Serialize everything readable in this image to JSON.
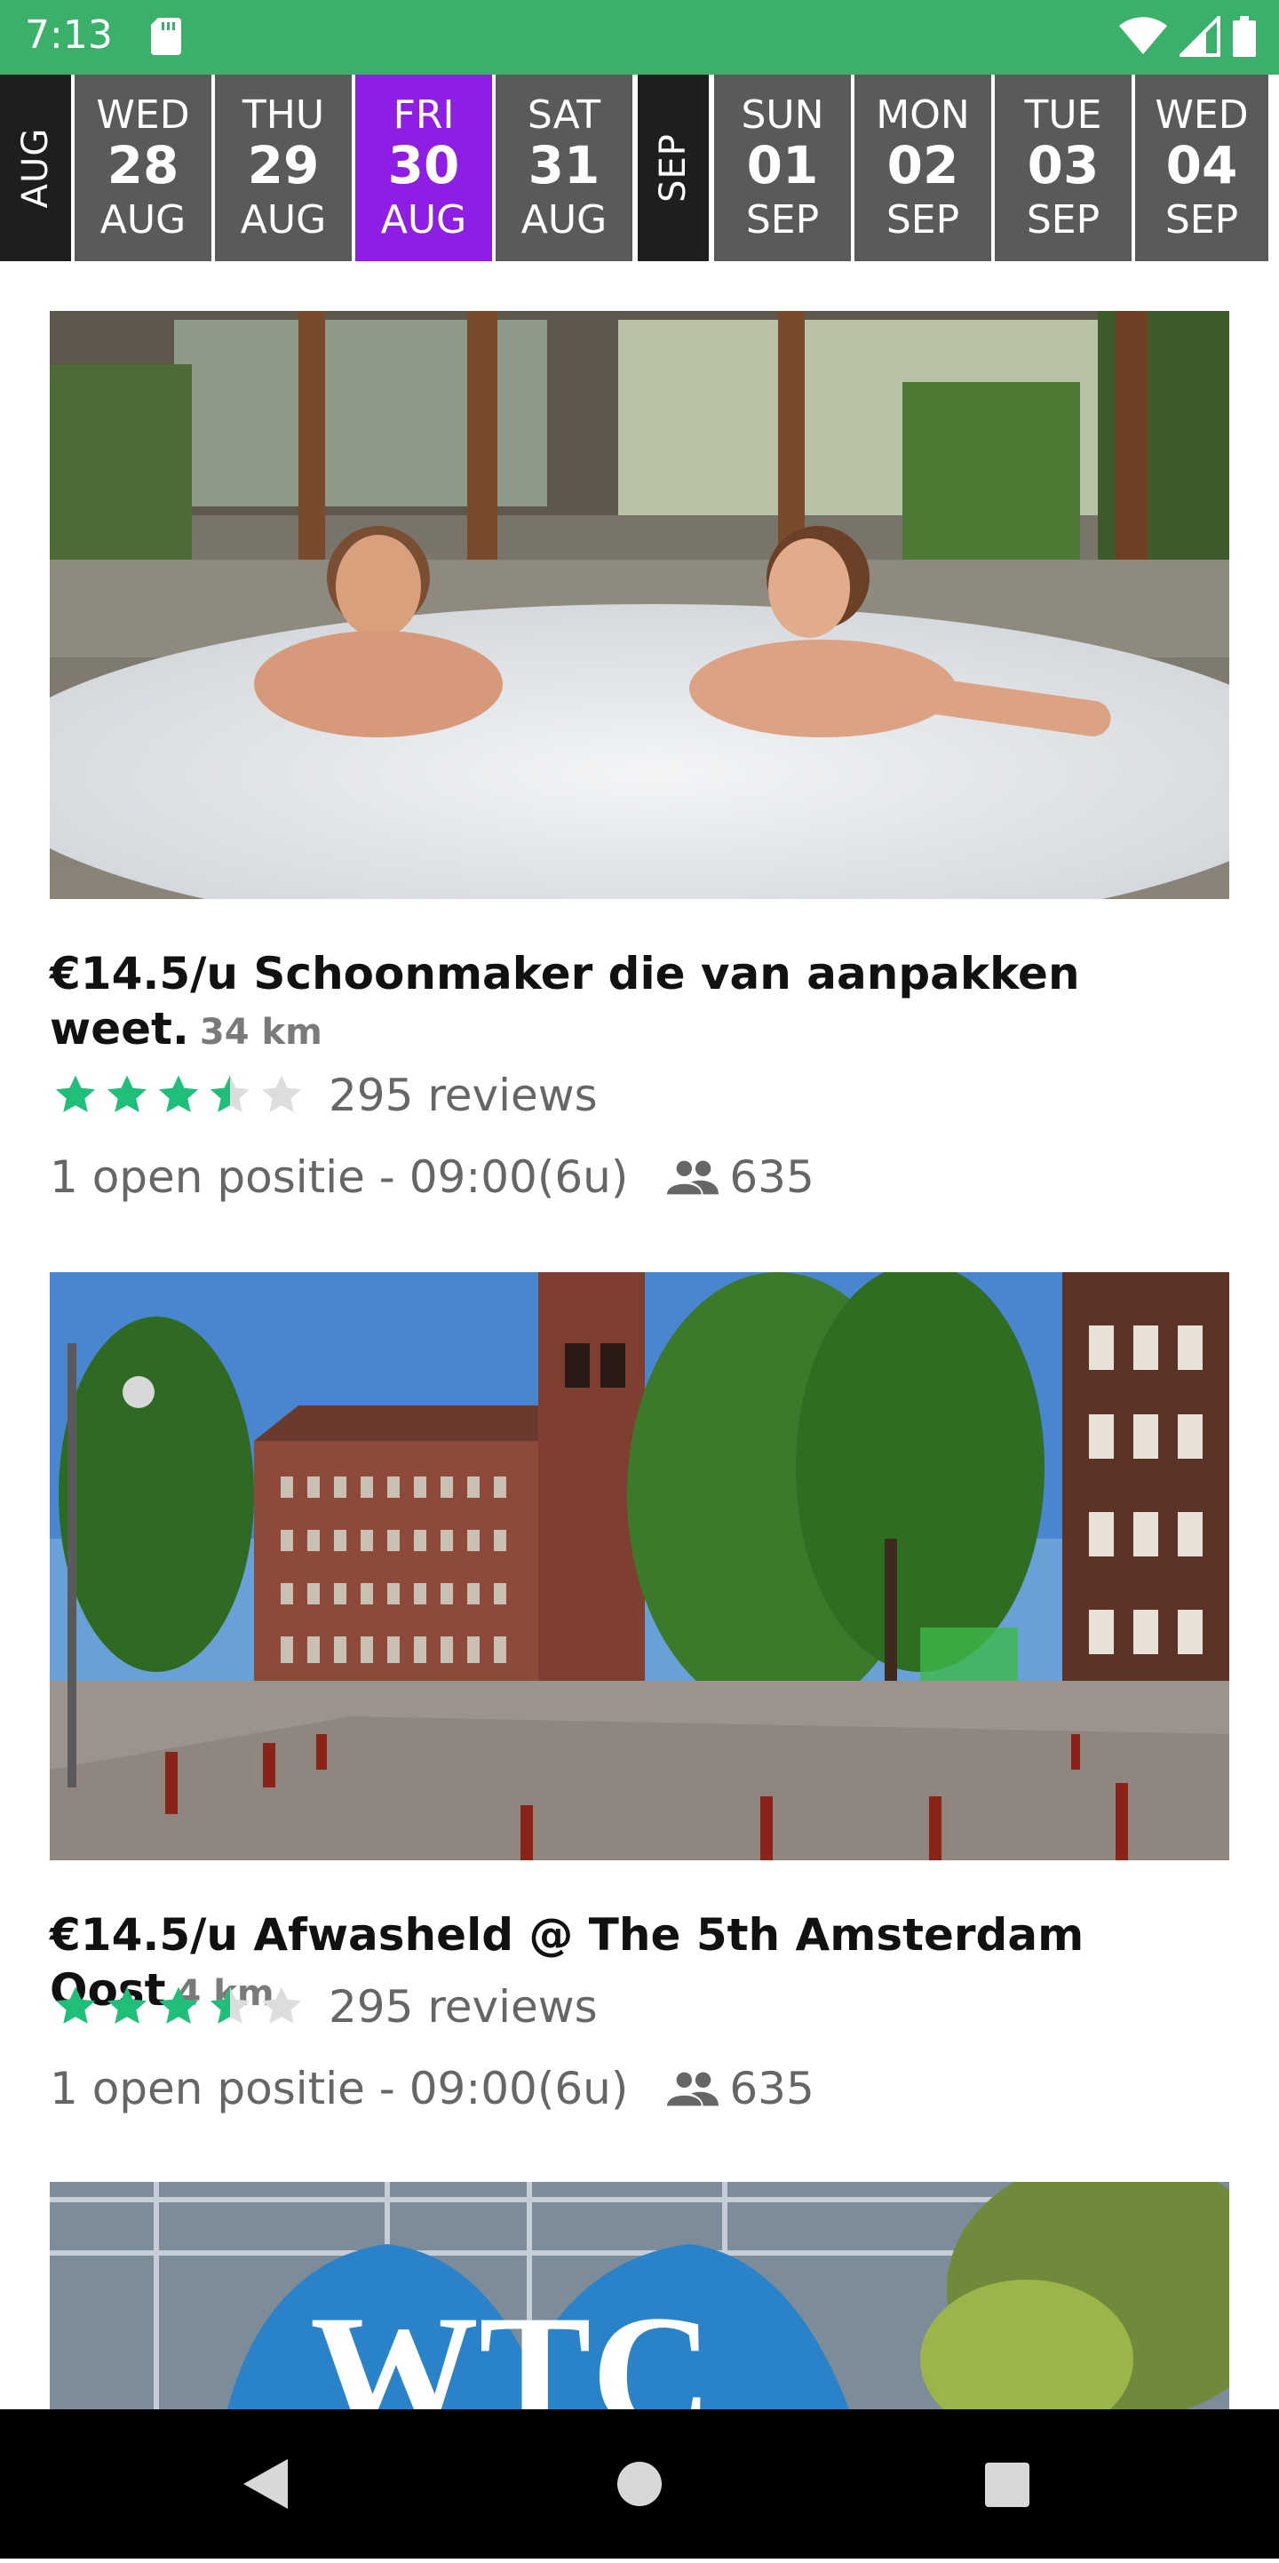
{
  "status_bar": {
    "time": "7:13",
    "icons": [
      "sd-card-icon",
      "wifi-icon",
      "signal-icon",
      "battery-icon"
    ]
  },
  "date_strip": {
    "selected_color": "#8e1ee3",
    "cells": [
      {
        "type": "month",
        "label": "AUG"
      },
      {
        "type": "day",
        "dow": "WED",
        "day": "28",
        "month": "AUG"
      },
      {
        "type": "day",
        "dow": "THU",
        "day": "29",
        "month": "AUG"
      },
      {
        "type": "day",
        "dow": "FRI",
        "day": "30",
        "month": "AUG",
        "selected": true
      },
      {
        "type": "day",
        "dow": "SAT",
        "day": "31",
        "month": "AUG"
      },
      {
        "type": "month",
        "label": "SEP"
      },
      {
        "type": "day",
        "dow": "SUN",
        "day": "01",
        "month": "SEP"
      },
      {
        "type": "day",
        "dow": "MON",
        "day": "02",
        "month": "SEP"
      },
      {
        "type": "day",
        "dow": "TUE",
        "day": "03",
        "month": "SEP"
      },
      {
        "type": "day",
        "dow": "WED",
        "day": "04",
        "month": "SEP"
      }
    ]
  },
  "jobs": [
    {
      "title": "€14.5/u Schoonmaker die van aanpakken weet.",
      "distance": "34 km",
      "rating": 3.5,
      "reviews": "295 reviews",
      "positions": "1 open positie - 09:00(6u)",
      "count": "635"
    },
    {
      "title": "€14.5/u Afwasheld @ The 5th Amsterdam Oost",
      "distance": "4 km",
      "rating": 3.5,
      "reviews": "295 reviews",
      "positions": "1 open positie - 09:00(6u)",
      "count": "635"
    }
  ],
  "third_card": {
    "image_text": "WTC"
  },
  "colors": {
    "status_bar": "#3bb06a",
    "star": "#1fbf7a",
    "day_cell": "#5a5a5a",
    "month_cell": "#1e1e1e"
  }
}
